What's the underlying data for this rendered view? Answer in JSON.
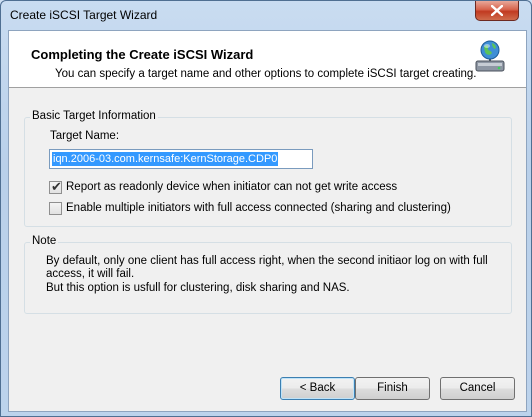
{
  "window": {
    "title": "Create iSCSI Target Wizard"
  },
  "header": {
    "title": "Completing the Create iSCSI Wizard",
    "subtitle": "You can specify a target name and other options to complete iSCSI target creating."
  },
  "basic_info": {
    "group_label": "Basic Target Information",
    "target_name_label": "Target Name:",
    "target_name_value": "iqn.2006-03.com.kernsafe:KernStorage.CDP0",
    "readonly_checkbox": {
      "label": "Report as readonly device when initiator can not get write access",
      "checked": true
    },
    "multi_initiator_checkbox": {
      "label": "Enable multiple initiators with  full access connected (sharing and clustering)",
      "checked": false
    }
  },
  "note": {
    "group_label": "Note",
    "line1": "By default, only one client has full access right, when the second initiaor log on with full",
    "line2": "access, it will fail.",
    "line3": "But this option is usfull for clustering, disk sharing and NAS."
  },
  "buttons": {
    "back": "< Back",
    "finish": "Finish",
    "cancel": "Cancel"
  },
  "icons": {
    "close": "close-icon",
    "header": "network-drive-globe-icon"
  }
}
